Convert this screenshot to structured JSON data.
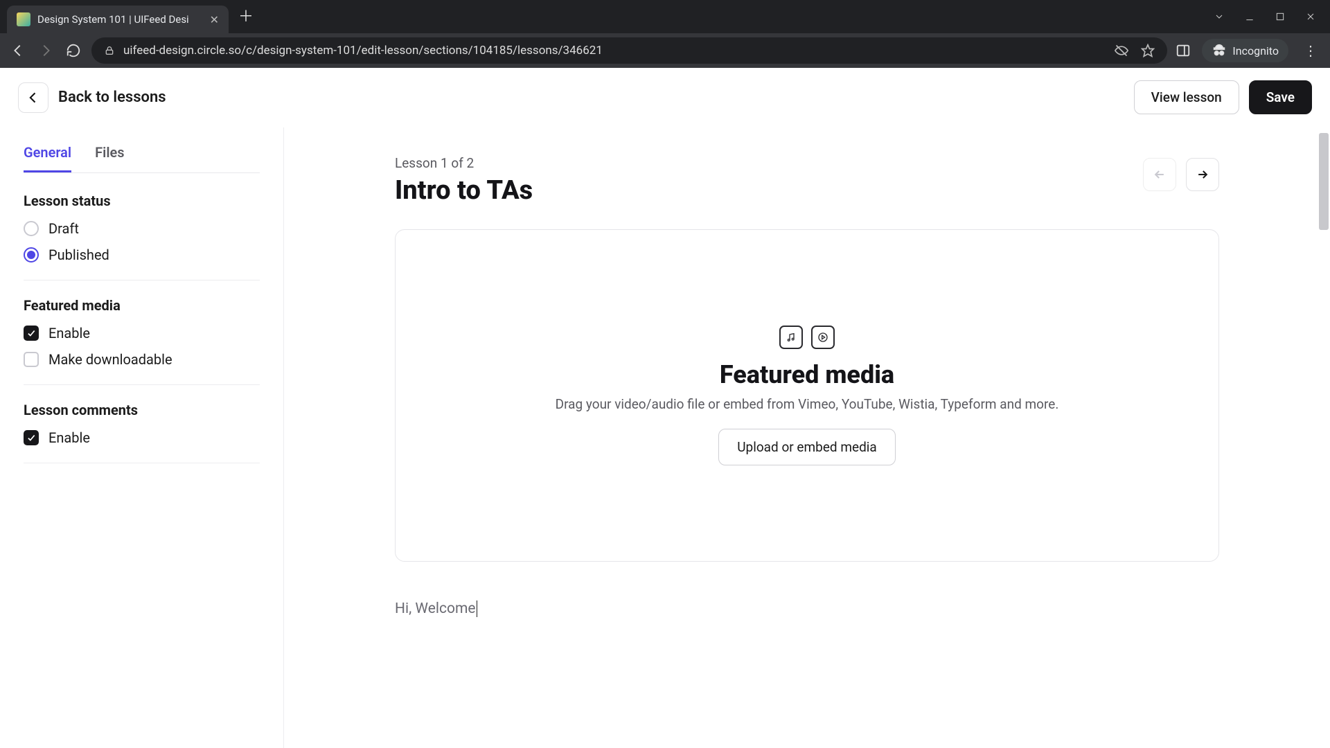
{
  "browser": {
    "tab_title": "Design System 101 | UIFeed Desi",
    "url": "uifeed-design.circle.so/c/design-system-101/edit-lesson/sections/104185/lessons/346621",
    "incognito_label": "Incognito"
  },
  "header": {
    "back_label": "Back to lessons",
    "view_lesson": "View lesson",
    "save": "Save"
  },
  "sidebar": {
    "tabs": {
      "general": "General",
      "files": "Files"
    },
    "status_title": "Lesson status",
    "status_options": {
      "draft": "Draft",
      "published": "Published"
    },
    "status_selected": "published",
    "featured_title": "Featured media",
    "featured_enable": "Enable",
    "featured_enable_checked": true,
    "featured_download": "Make downloadable",
    "featured_download_checked": false,
    "comments_title": "Lesson comments",
    "comments_enable": "Enable",
    "comments_enable_checked": true
  },
  "main": {
    "lesson_counter": "Lesson 1 of 2",
    "lesson_title": "Intro to TAs",
    "media": {
      "title": "Featured media",
      "subtitle": "Drag your video/audio file or embed from Vimeo, YouTube, Wistia, Typeform and more.",
      "button": "Upload or embed media"
    },
    "editor_text": "Hi, Welcome"
  }
}
